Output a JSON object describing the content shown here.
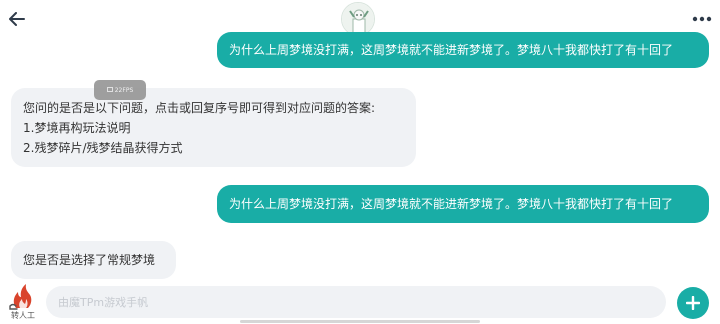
{
  "header": {
    "back_icon": "arrow-left-icon",
    "avatar_icon": "assistant-avatar-icon",
    "more_icon": "more-dots-icon"
  },
  "messages": [
    {
      "side": "out",
      "text": "为什么上周梦境没打满，这周梦境就不能进新梦境了。梦境八十我都快打了有十回了"
    },
    {
      "side": "in",
      "lines": [
        "您问的是否是以下问题，点击或回复序号即可得到对应问题的答案:",
        "1.梦境再构玩法说明",
        "2.残梦碎片/残梦结晶获得方式"
      ]
    },
    {
      "side": "out",
      "text": "为什么上周梦境没打满，这周梦境就不能进新梦境了。梦境八十我都快打了有十回了"
    },
    {
      "side": "in",
      "text": "您是否是选择了常规梦境"
    }
  ],
  "overlay": {
    "fps_text": "22FPS"
  },
  "footer": {
    "transfer_label": "转人工",
    "input_placeholder": "由魔TPm游戏手帆",
    "plus_icon": "plus-icon"
  },
  "colors": {
    "accent": "#19ada6",
    "incoming_bubble": "#f0f2f5",
    "text": "#333333"
  }
}
